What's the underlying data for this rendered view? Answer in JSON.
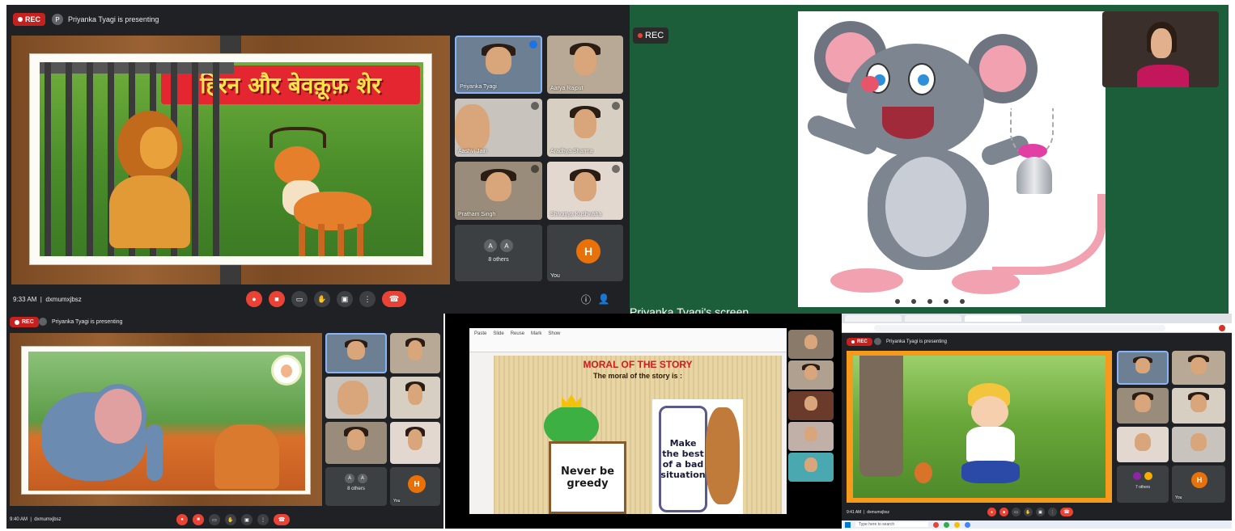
{
  "panel1": {
    "rec": "REC",
    "presenter_initial": "P",
    "presenting_text": "Priyanka Tyagi is presenting",
    "title_hindi": "हिरन और बेवक़ूफ़ शेर",
    "participants": [
      {
        "name": "Priyanka Tyagi"
      },
      {
        "name": "Aarya Rajput"
      },
      {
        "name": "Aashvi Jain"
      },
      {
        "name": "Aradhya Sharma"
      },
      {
        "name": "Pratham Singh"
      },
      {
        "name": "Shivanya Kushwaha"
      }
    ],
    "others_initials": [
      "A",
      "A"
    ],
    "others_label": "8 others",
    "you_label": "You",
    "you_initial": "H",
    "time": "9:33 AM",
    "meeting_code": "dxmumxjbsz"
  },
  "panel2": {
    "rec": "REC",
    "screen_caption": "Priyanka Tyagi's screen"
  },
  "panel3": {
    "rec": "REC",
    "presenting_text": "Priyanka Tyagi is presenting",
    "others_initials": [
      "A",
      "A"
    ],
    "others_label": "8 others",
    "you_label": "You",
    "you_initial": "H",
    "time": "9:40 AM",
    "meeting_code": "dxmumxjbsz"
  },
  "panel4": {
    "ribbon": [
      "Paste",
      "Slide",
      "Reuse",
      "Mark",
      "Show"
    ],
    "heading": "MORAL OF THE STORY",
    "subheading": "The moral of the story is :",
    "card_left": "Never be greedy",
    "card_right": "Make the best of a bad situation"
  },
  "panel5": {
    "rec": "REC",
    "presenting_text": "Priyanka Tyagi is presenting",
    "others_label": "7 others",
    "you_label": "You",
    "you_initial": "H",
    "time": "9:41 AM",
    "meeting_code": "dxmumxjbsz",
    "search_placeholder": "Type here to search"
  }
}
